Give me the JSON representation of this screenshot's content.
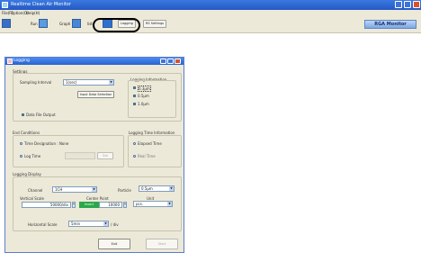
{
  "main_window": {
    "title": "Realtime Clean Air Monitor",
    "menu": [
      "File(F)",
      "Option(O)",
      "Help(H)"
    ],
    "toolbar": {
      "run_label": "Run",
      "graph_label": "Graph",
      "list_label": "list",
      "logging_label": "Logging",
      "rs_settings_label": "RS Settings"
    },
    "brand": "RGA Monitor"
  },
  "logging_dialog": {
    "title": "Logging",
    "settings": {
      "group_label": "Settings",
      "sampling_interval_label": "Sampling Interval",
      "sampling_interval_value": "1(sec)",
      "input_data_selection_button": "Input Data Selection",
      "data_file_output_label": "Data File Output",
      "logging_information_label": "Logging Information",
      "info_items": [
        "0.3μm",
        "0.5μm",
        "1.0μm"
      ]
    },
    "end_conditions": {
      "group_label": "End Conditions",
      "time_designation_label": "Time Designation : None",
      "log_time_label": "Log Time",
      "log_time_button": "Set"
    },
    "logging_time_information": {
      "group_label": "Logging Time Information",
      "elapsed_time_label": "Elapsed Time",
      "real_time_label": "Real Time"
    },
    "logging_display": {
      "group_label": "Logging Display",
      "channel_label": "Channel",
      "channel_value": "1CH",
      "particle_label": "Particle",
      "particle_value": "0.5μm",
      "vertical_scale_label": "Vertical Scale",
      "vertical_scale_value": "50000/div",
      "center_point_label": "Center Point",
      "center_point_badge": "Invert",
      "center_point_value": "10000",
      "unit_label": "Unit",
      "unit_value": "pcs.",
      "horizontal_scale_label": "Horizontal Scale",
      "horizontal_scale_value": "5min",
      "horizontal_scale_suffix": "/ div"
    },
    "buttons": {
      "exit": "Exit",
      "start": "Start"
    }
  }
}
